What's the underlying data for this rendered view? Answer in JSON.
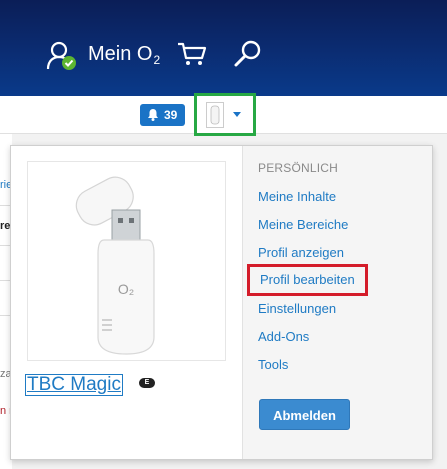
{
  "header": {
    "account_label": "Mein O",
    "account_sub": "2"
  },
  "notifications": {
    "count": "39"
  },
  "product": {
    "name": "TBC Magic",
    "badge": "E",
    "image_brand": "O₂"
  },
  "menu": {
    "heading": "PERSÖNLICH",
    "items": [
      {
        "label": "Meine Inhalte"
      },
      {
        "label": "Meine Bereiche"
      },
      {
        "label": "Profil anzeigen"
      },
      {
        "label": "Profil bearbeiten"
      },
      {
        "label": "Einstellungen"
      },
      {
        "label": "Add-Ons"
      },
      {
        "label": "Tools"
      }
    ],
    "logout_label": "Abmelden"
  },
  "background": {
    "fragments": [
      "rie",
      "re",
      "za",
      "n r"
    ]
  },
  "colors": {
    "header": "#0b2a6e",
    "link": "#1f7bc4",
    "highlight_red": "#d41c2a",
    "highlight_green": "#27a844"
  }
}
